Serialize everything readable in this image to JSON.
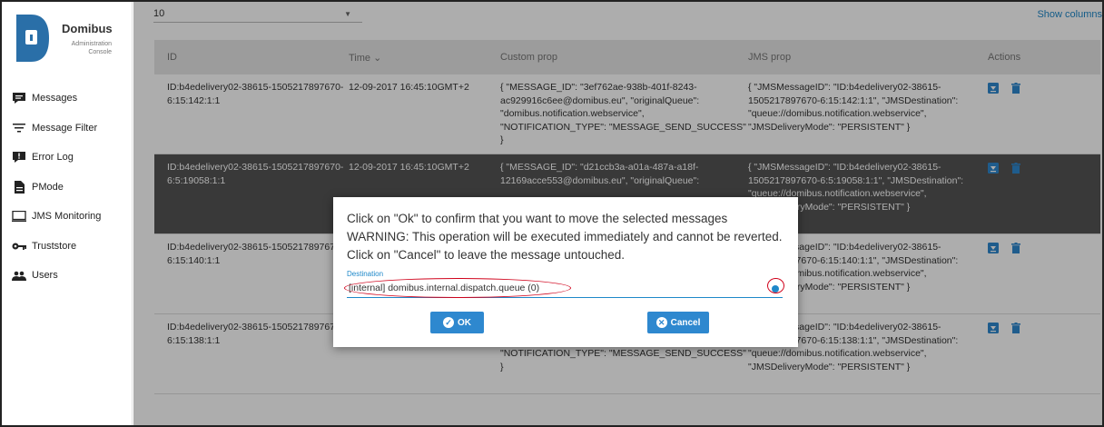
{
  "brand": {
    "name": "Domibus",
    "subtitle": "Administration Console",
    "logo_letter": "D"
  },
  "nav": [
    {
      "label": "Messages",
      "icon": "message-icon"
    },
    {
      "label": "Message Filter",
      "icon": "filter-icon"
    },
    {
      "label": "Error Log",
      "icon": "error-icon"
    },
    {
      "label": "PMode",
      "icon": "file-icon"
    },
    {
      "label": "JMS Monitoring",
      "icon": "monitor-icon"
    },
    {
      "label": "Truststore",
      "icon": "key-icon"
    },
    {
      "label": "Users",
      "icon": "users-icon"
    }
  ],
  "toolbar": {
    "page_size": "10",
    "show_columns": "Show columns"
  },
  "table": {
    "headers": {
      "id": "ID",
      "time": "Time ⌄",
      "custom": "Custom prop",
      "jms": "JMS prop",
      "actions": "Actions"
    },
    "rows": [
      {
        "id": "ID:b4edelivery02-38615-1505217897670-6:15:142:1:1",
        "time": "12-09-2017 16:45:10GMT+2",
        "custom": "{ \"MESSAGE_ID\": \"3ef762ae-938b-401f-8243-ac929916c6ee@domibus.eu\", \"originalQueue\": \"domibus.notification.webservice\", \"NOTIFICATION_TYPE\": \"MESSAGE_SEND_SUCCESS\" }",
        "jms": "{ \"JMSMessageID\": \"ID:b4edelivery02-38615-1505217897670-6:15:142:1:1\", \"JMSDestination\": \"queue://domibus.notification.webservice\", \"JMSDeliveryMode\": \"PERSISTENT\" }",
        "selected": false
      },
      {
        "id": "ID:b4edelivery02-38615-1505217897670-6:5:19058:1:1",
        "time": "12-09-2017 16:45:10GMT+2",
        "custom": "{ \"MESSAGE_ID\": \"d21ccb3a-a01a-487a-a18f-12169acce553@domibus.eu\", \"originalQueue\":",
        "jms": "{ \"JMSMessageID\": \"ID:b4edelivery02-38615-1505217897670-6:5:19058:1:1\", \"JMSDestination\": \"queue://domibus.notification.webservice\", \"JMSDeliveryMode\": \"PERSISTENT\" }",
        "selected": true
      },
      {
        "id": "ID:b4edelivery02-38615-1505217897670-6:15:140:1:1",
        "time": "",
        "custom": "",
        "jms": "{ \"JMSMessageID\": \"ID:b4edelivery02-38615-1505217897670-6:15:140:1:1\", \"JMSDestination\": \"queue://domibus.notification.webservice\", \"JMSDeliveryMode\": \"PERSISTENT\" }",
        "selected": false
      },
      {
        "id": "ID:b4edelivery02-38615-1505217897670-6:15:138:1:1",
        "time": "",
        "custom": "0fbdd6a806bb@domibus.eu\", \"originalQueue\": \"domibus.notification.webservice\", \"NOTIFICATION_TYPE\": \"MESSAGE_SEND_SUCCESS\" }",
        "jms": "{ \"JMSMessageID\": \"ID:b4edelivery02-38615-1505217897670-6:15:138:1:1\", \"JMSDestination\": \"queue://domibus.notification.webservice\", \"JMSDeliveryMode\": \"PERSISTENT\" }",
        "selected": false
      }
    ]
  },
  "dialog": {
    "line1": "Click on \"Ok\" to confirm that you want to move the selected messages",
    "line2": "WARNING: This operation will be executed immediately and cannot be reverted.",
    "line3": "Click on \"Cancel\" to leave the message untouched.",
    "destination_label": "Destination",
    "destination_value": "[internal] domibus.internal.dispatch.queue (0)",
    "ok_label": "OK",
    "cancel_label": "Cancel"
  },
  "colors": {
    "accent": "#2e88cf",
    "highlight": "#d0021b",
    "selected_row": "#555555"
  }
}
